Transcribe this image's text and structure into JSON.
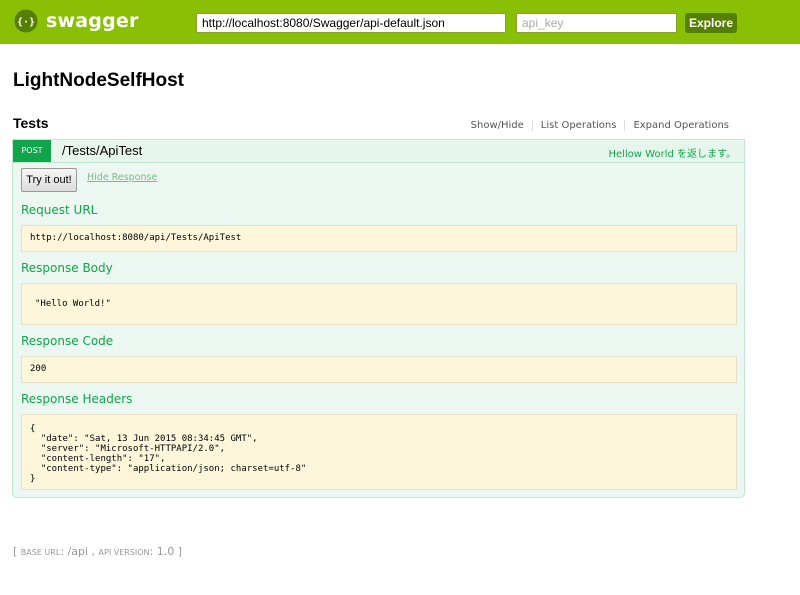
{
  "header": {
    "logo_text": "swagger",
    "url_value": "http://localhost:8080/Swagger/api-default.json",
    "api_key_placeholder": "api_key",
    "explore_label": "Explore"
  },
  "page": {
    "title": "LightNodeSelfHost"
  },
  "resource": {
    "name": "Tests",
    "links": [
      "Show/Hide",
      "List Operations",
      "Expand Operations"
    ]
  },
  "operation": {
    "method": "POST",
    "path": "/Tests/ApiTest",
    "summary": "Hellow World を返します。",
    "try_label": "Try it out!",
    "hide_response_label": "Hide Response",
    "request_url_heading": "Request URL",
    "request_url": "http://localhost:8080/api/Tests/ApiTest",
    "response_body_heading": "Response Body",
    "response_body": "\"Hello World!\"",
    "response_code_heading": "Response Code",
    "response_code": "200",
    "response_headers_heading": "Response Headers",
    "response_headers": "{\n  \"date\": \"Sat, 13 Jun 2015 08:34:45 GMT\",\n  \"server\": \"Microsoft-HTTPAPI/2.0\",\n  \"content-length\": \"17\",\n  \"content-type\": \"application/json; charset=utf-8\"\n}"
  },
  "footer": {
    "open": "[ ",
    "base_url_label": "base url",
    "base_url": "/api",
    "api_version_label": "api version",
    "api_version": "1.0",
    "close": " ]"
  },
  "colors": {
    "header_bg": "#89bf04",
    "method_post": "#10a54a",
    "response_box": "#fcf6db"
  }
}
